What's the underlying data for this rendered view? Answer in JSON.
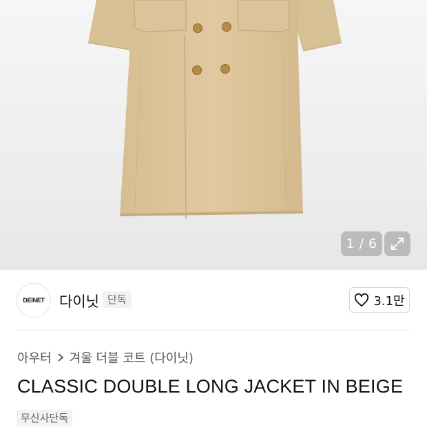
{
  "image_viewer": {
    "counter_text": "1 / 6",
    "expand_icon": "expand-icon",
    "product_image": "beige-double-long-coat"
  },
  "brand": {
    "logo_text": "DEINET",
    "name": "다이닛",
    "tag": "단독",
    "like_icon": "heart-icon",
    "like_count": "3.1만"
  },
  "breadcrumb": {
    "category": "아우터",
    "separator_icon": "chevron-right-icon",
    "subcategory": "겨울 더블 코트 (다이닛)"
  },
  "product": {
    "title": "CLASSIC DOUBLE LONG JACKET IN BEIGE",
    "badge": "무신사단독"
  },
  "colors": {
    "coat": "#dcc59c",
    "button": "#b8904a",
    "overlay": "#9a9a9a"
  }
}
